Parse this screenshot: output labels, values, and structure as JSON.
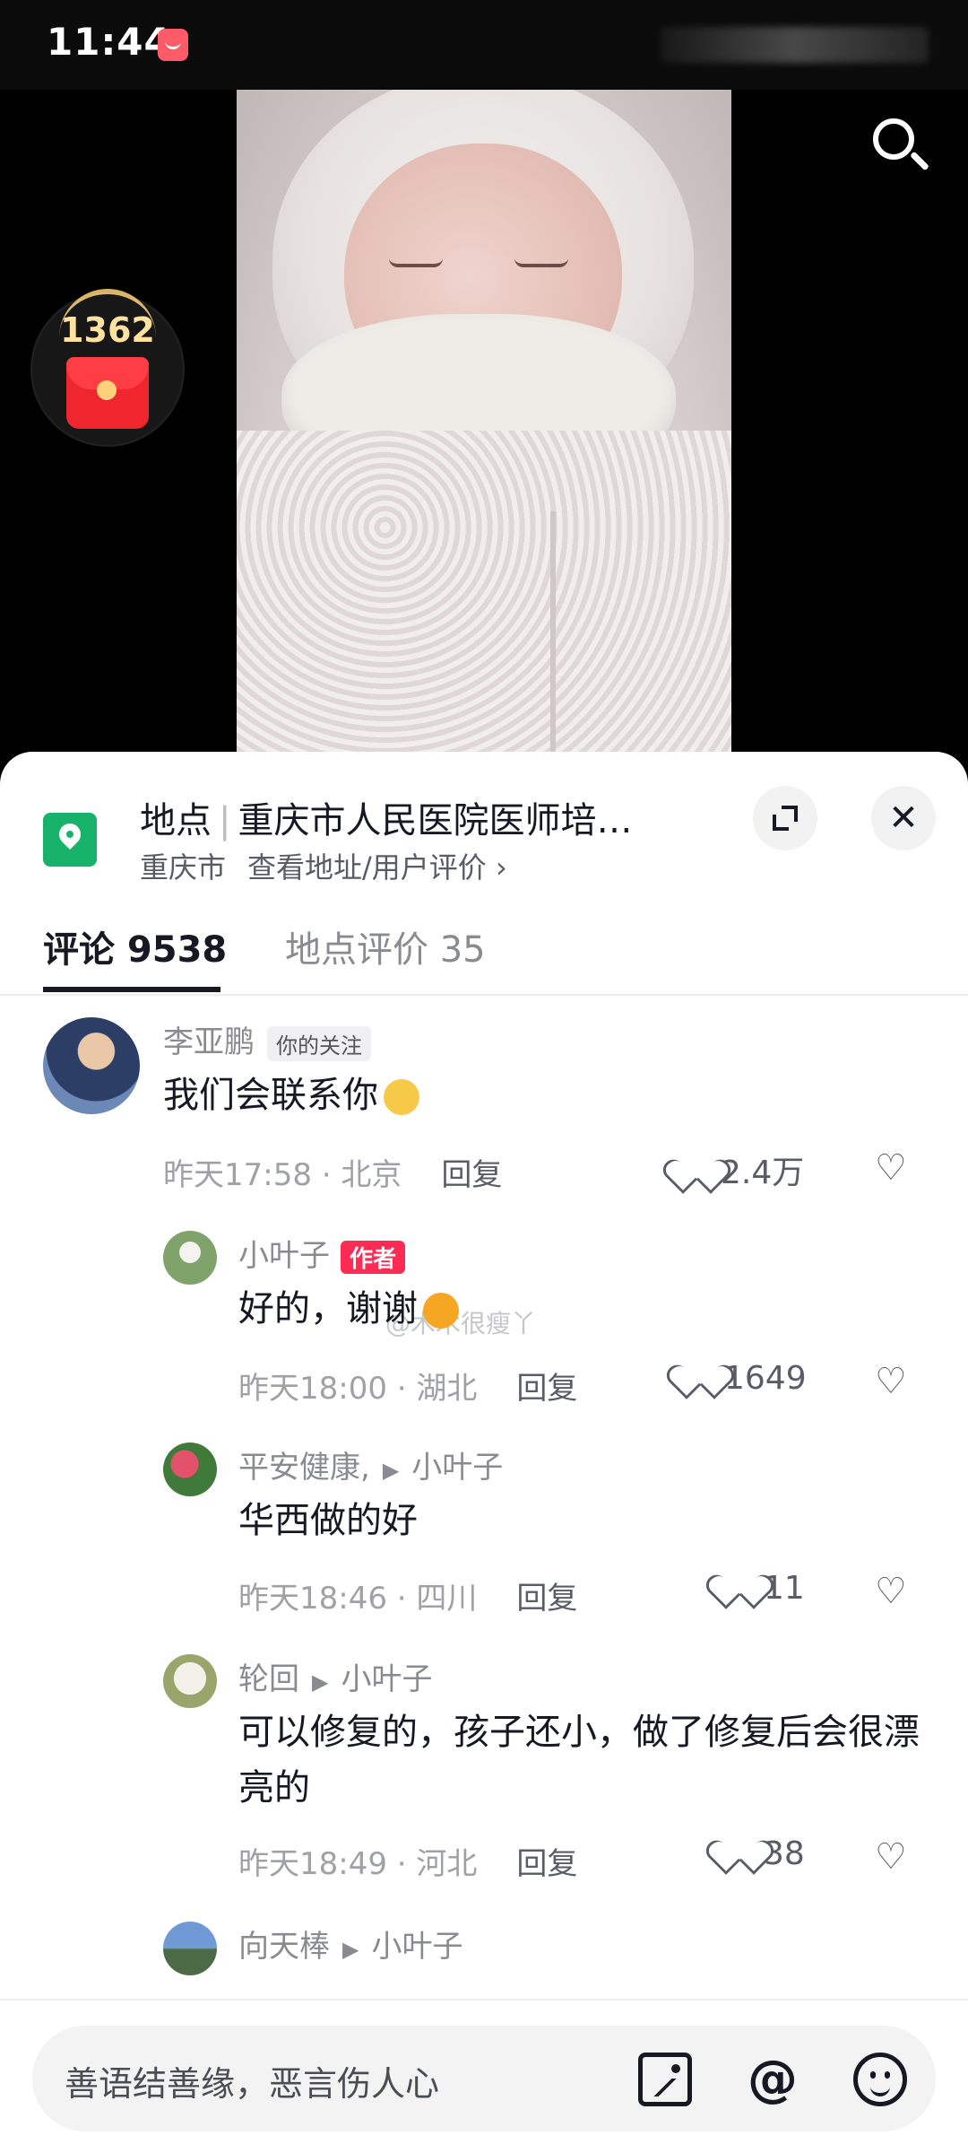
{
  "status_bar": {
    "time": "11:44"
  },
  "video": {
    "coin_count": "1362"
  },
  "location": {
    "label": "地点",
    "name": "重庆市人民医院医师培…",
    "city": "重庆市",
    "link": "查看地址/用户评价 ›"
  },
  "tabs": {
    "comments": "评论 9538",
    "reviews": "地点评价 35"
  },
  "watermark": "@木木很瘦丫",
  "comments": [
    {
      "name": "李亚鹏",
      "tag": "你的关注",
      "text": "我们会联系你",
      "time": "昨天17:58 · 北京",
      "reply": "回复",
      "likes": "2.4万"
    },
    {
      "name": "小叶子",
      "tag": "作者",
      "text": "好的，谢谢",
      "time": "昨天18:00 · 湖北",
      "reply": "回复",
      "likes": "1649"
    },
    {
      "name": "平安健康,",
      "reply_to": "小叶子",
      "text": "华西做的好",
      "time": "昨天18:46 · 四川",
      "reply": "回复",
      "likes": "11"
    },
    {
      "name": "轮回",
      "reply_to": "小叶子",
      "text": "可以修复的，孩子还小，做了修复后会很漂亮的",
      "time": "昨天18:49 · 河北",
      "reply": "回复",
      "likes": "38"
    },
    {
      "name": "向天棒",
      "reply_to": "小叶子"
    }
  ],
  "input": {
    "placeholder": "善语结善缘，恶言伤人心"
  }
}
